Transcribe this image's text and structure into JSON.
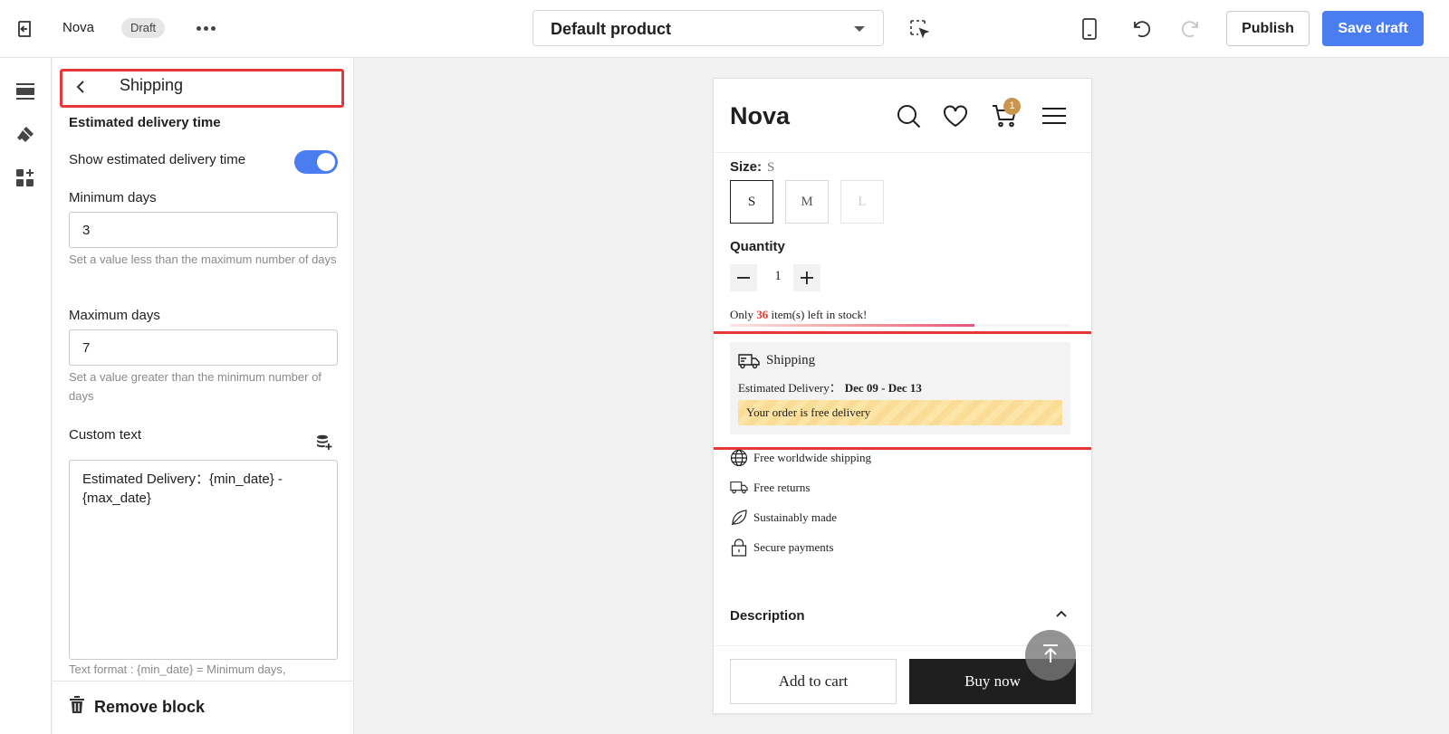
{
  "topbar": {
    "title": "Nova",
    "badge": "Draft",
    "template_select": "Default product",
    "publish_label": "Publish",
    "save_label": "Save draft"
  },
  "panel": {
    "title": "Shipping",
    "section_title": "Estimated delivery time",
    "show_label": "Show estimated delivery time",
    "show_enabled": true,
    "min_label": "Minimum days",
    "min_value": "3",
    "min_help": "Set a value less than the maximum number of days",
    "max_label": "Maximum days",
    "max_value": "7",
    "max_help": "Set a value greater than the minimum number of days",
    "custom_label": "Custom text",
    "custom_value": "Estimated Delivery：{min_date} - {max_date}",
    "format_help": "Text format : {min_date} = Minimum days,",
    "remove_label": "Remove block"
  },
  "preview": {
    "logo": "Nova",
    "cart_count": "1",
    "size_label": "Size:",
    "size_value": "S",
    "sizes": [
      "S",
      "M",
      "L"
    ],
    "quantity_label": "Quantity",
    "quantity_value": "1",
    "stock_prefix": "Only ",
    "stock_count": "36",
    "stock_suffix": " item(s) left in stock!",
    "stock_level": 0.72,
    "shipping_title": "Shipping",
    "estimated_label": "Estimated Delivery：",
    "estimated_range": "Dec 09 - Dec 13",
    "free_delivery": "Your order is free delivery",
    "features": [
      "Free worldwide shipping",
      "Free returns",
      "Sustainably made",
      "Secure payments"
    ],
    "description_label": "Description",
    "add_to_cart": "Add to cart",
    "buy_now": "Buy now"
  },
  "colors": {
    "accent": "#4a7ef0",
    "highlight": "#e53935",
    "badge": "#c8964f"
  }
}
